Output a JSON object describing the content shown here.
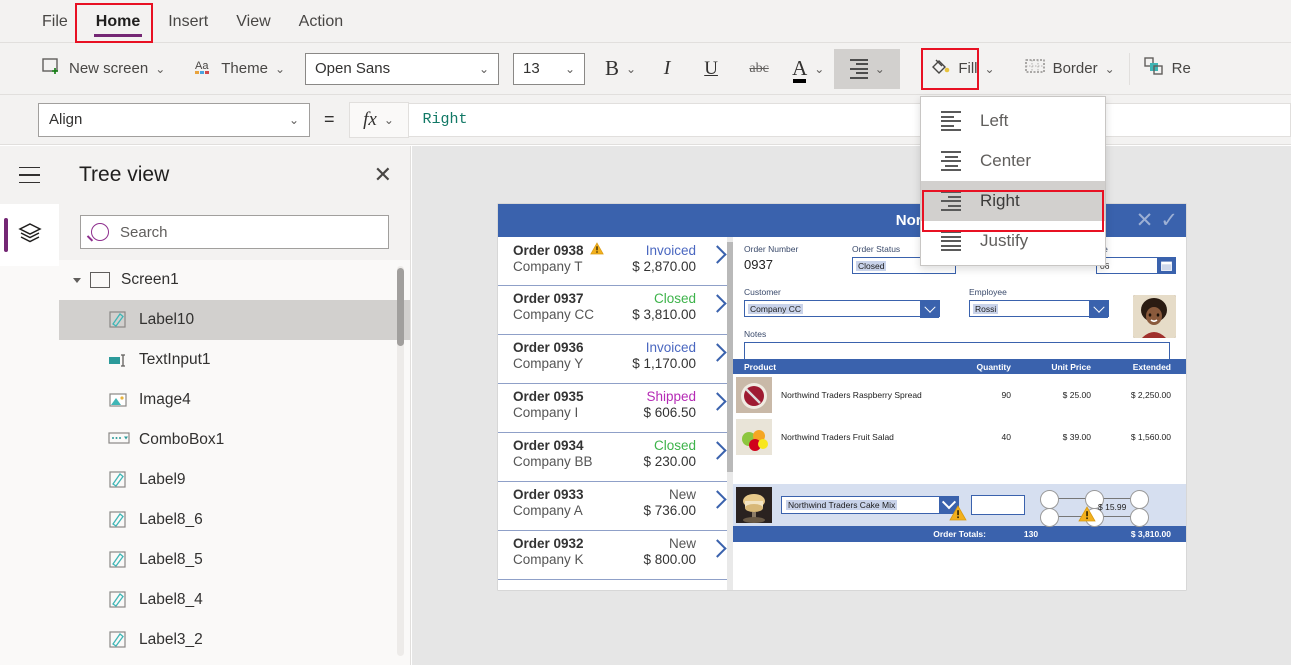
{
  "menubar": {
    "items": [
      {
        "label": "File",
        "active": false
      },
      {
        "label": "Home",
        "active": true
      },
      {
        "label": "Insert",
        "active": false
      },
      {
        "label": "View",
        "active": false
      },
      {
        "label": "Action",
        "active": false
      }
    ],
    "accent_underline": "#742774"
  },
  "ribbon": {
    "new_screen": "New screen",
    "theme": "Theme",
    "font_family": "Open Sans",
    "font_size": "13",
    "bold": "B",
    "italic": "I",
    "underline": "U",
    "strikethrough": "abc",
    "font_color": "A",
    "align": "align",
    "fill": "Fill",
    "border": "Border",
    "reorder": "Re",
    "highlight_color": "#d2d0ce",
    "selection_box_color": "#e81123"
  },
  "propertybar": {
    "property_name": "Align",
    "equals": "=",
    "fx": "fx",
    "formula_value": "Right",
    "formula_color": "#117865"
  },
  "align_menu": {
    "items": [
      {
        "label": "Left",
        "icon": "align-left-icon",
        "selected": false
      },
      {
        "label": "Center",
        "icon": "align-center-icon",
        "selected": false
      },
      {
        "label": "Right",
        "icon": "align-right-icon",
        "selected": true
      },
      {
        "label": "Justify",
        "icon": "align-justify-icon",
        "selected": false
      }
    ]
  },
  "treeview": {
    "title": "Tree view",
    "close": "✕",
    "search_placeholder": "Search",
    "root": {
      "label": "Screen1",
      "expanded": true
    },
    "items": [
      {
        "label": "Label10",
        "icon": "label-icon",
        "selected": true
      },
      {
        "label": "TextInput1",
        "icon": "textinput-icon",
        "selected": false
      },
      {
        "label": "Image4",
        "icon": "image-icon",
        "selected": false
      },
      {
        "label": "ComboBox1",
        "icon": "combobox-icon",
        "selected": false
      },
      {
        "label": "Label9",
        "icon": "label-icon",
        "selected": false
      },
      {
        "label": "Label8_6",
        "icon": "label-icon",
        "selected": false
      },
      {
        "label": "Label8_5",
        "icon": "label-icon",
        "selected": false
      },
      {
        "label": "Label8_4",
        "icon": "label-icon",
        "selected": false
      },
      {
        "label": "Label3_2",
        "icon": "label-icon",
        "selected": false
      }
    ]
  },
  "app": {
    "header_color": "#3a62ad",
    "title": "Northwind Orders",
    "gallery": [
      {
        "order": "Order 0938",
        "company": "Company T",
        "status": "Invoiced",
        "amount": "$ 2,870.00",
        "warning": true
      },
      {
        "order": "Order 0937",
        "company": "Company CC",
        "status": "Closed",
        "amount": "$ 3,810.00",
        "warning": false
      },
      {
        "order": "Order 0936",
        "company": "Company Y",
        "status": "Invoiced",
        "amount": "$ 1,170.00",
        "warning": false
      },
      {
        "order": "Order 0935",
        "company": "Company I",
        "status": "Shipped",
        "amount": "$ 606.50",
        "warning": false
      },
      {
        "order": "Order 0934",
        "company": "Company BB",
        "status": "Closed",
        "amount": "$ 230.00",
        "warning": false
      },
      {
        "order": "Order 0933",
        "company": "Company A",
        "status": "New",
        "amount": "$ 736.00",
        "warning": false
      },
      {
        "order": "Order 0932",
        "company": "Company K",
        "status": "New",
        "amount": "$ 800.00",
        "warning": false
      }
    ],
    "detail": {
      "cancel": "✕",
      "confirm": "✓",
      "order_number_label": "Order Number",
      "order_number_value": "0937",
      "order_status_label": "Order Status",
      "order_status_value": "Closed",
      "date_label": "ate",
      "date_value": "06",
      "customer_label": "Customer",
      "customer_value": "Company CC",
      "employee_label": "Employee",
      "employee_value": "Rossi",
      "notes_label": "Notes",
      "notes_value": ""
    },
    "products": {
      "headers": [
        "Product",
        "Quantity",
        "Unit Price",
        "Extended"
      ],
      "rows": [
        {
          "name": "Northwind Traders Raspberry Spread",
          "qty": "90",
          "price": "$ 25.00",
          "ext": "$ 2,250.00"
        },
        {
          "name": "Northwind Traders Fruit Salad",
          "qty": "40",
          "price": "$ 39.00",
          "ext": "$ 1,560.00"
        }
      ],
      "edit_row": {
        "product": "Northwind Traders Cake Mix",
        "qty": "",
        "price": "$ 15.99"
      },
      "totals_label": "Order Totals:",
      "totals_qty": "130",
      "totals_amount": "$ 3,810.00"
    }
  }
}
